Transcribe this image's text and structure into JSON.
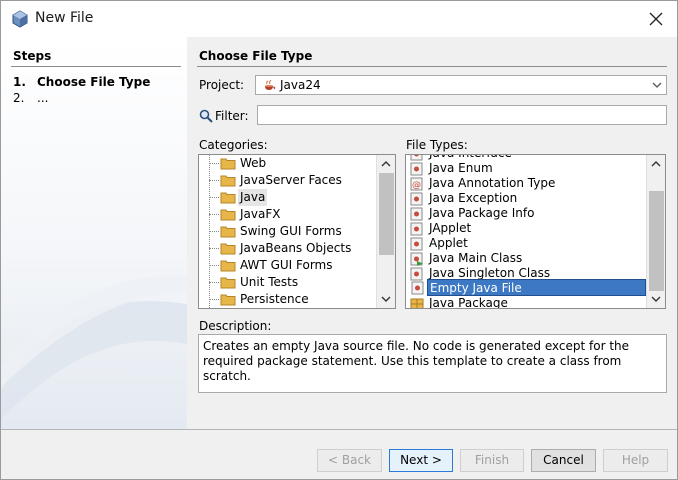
{
  "window": {
    "title": "New File",
    "icon": "netbeans-cube-icon"
  },
  "steps": {
    "title": "Steps",
    "items": [
      {
        "num": "1.",
        "label": "Choose File Type"
      },
      {
        "num": "2.",
        "label": "..."
      }
    ]
  },
  "main": {
    "title": "Choose File Type",
    "project": {
      "label": "Project:",
      "value": "Java24",
      "icon": "java-project-icon"
    },
    "filter": {
      "label": "Filter:",
      "value": "",
      "placeholder": ""
    },
    "categories": {
      "label": "Categories:",
      "items": [
        "Web",
        "JavaServer Faces",
        "Java",
        "JavaFX",
        "Swing GUI Forms",
        "JavaBeans Objects",
        "AWT GUI Forms",
        "Unit Tests",
        "Persistence"
      ],
      "selected": "Java"
    },
    "file_types": {
      "label": "File Types:",
      "partial_top": "Java Interface",
      "items": [
        "Java Enum",
        "Java Annotation Type",
        "Java Exception",
        "Java Package Info",
        "JApplet",
        "Applet",
        "Java Main Class",
        "Java Singleton Class",
        "Empty Java File",
        "Java Package"
      ],
      "selected": "Empty Java File"
    },
    "description": {
      "label": "Description:",
      "text": "Creates an empty Java source file. No code is generated except for the required package statement. Use this template to create a class from scratch."
    }
  },
  "buttons": {
    "back": "< Back",
    "next": "Next >",
    "finish": "Finish",
    "cancel": "Cancel",
    "help": "Help"
  },
  "colors": {
    "selection": "#3c78c3",
    "folder": "#e8b648"
  }
}
